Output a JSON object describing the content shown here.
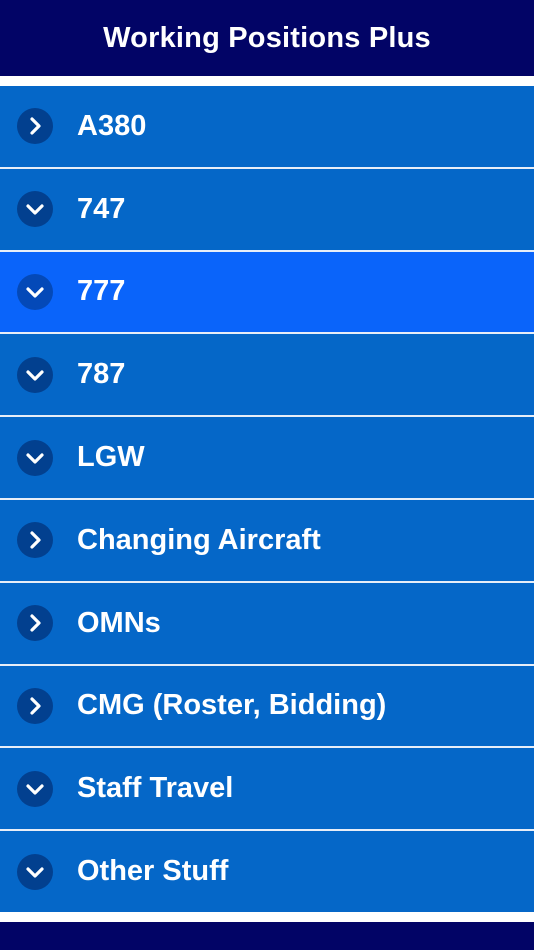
{
  "header": {
    "title": "Working Positions Plus"
  },
  "colors": {
    "header_bg": "#020466",
    "row_bg": "#0567c8",
    "row_selected_bg": "#0a64fa",
    "chevron_bg": "#02408f",
    "text": "#ffffff"
  },
  "menu": {
    "items": [
      {
        "label": "A380",
        "icon": "chevron-right-icon"
      },
      {
        "label": "747",
        "icon": "chevron-down-icon"
      },
      {
        "label": "777",
        "icon": "chevron-down-icon",
        "selected": true
      },
      {
        "label": "787",
        "icon": "chevron-down-icon"
      },
      {
        "label": "LGW",
        "icon": "chevron-down-icon"
      },
      {
        "label": "Changing Aircraft",
        "icon": "chevron-right-icon"
      },
      {
        "label": "OMNs",
        "icon": "chevron-right-icon"
      },
      {
        "label": "CMG (Roster, Bidding)",
        "icon": "chevron-right-icon"
      },
      {
        "label": "Staff Travel",
        "icon": "chevron-down-icon"
      },
      {
        "label": "Other Stuff",
        "icon": "chevron-down-icon"
      }
    ]
  }
}
